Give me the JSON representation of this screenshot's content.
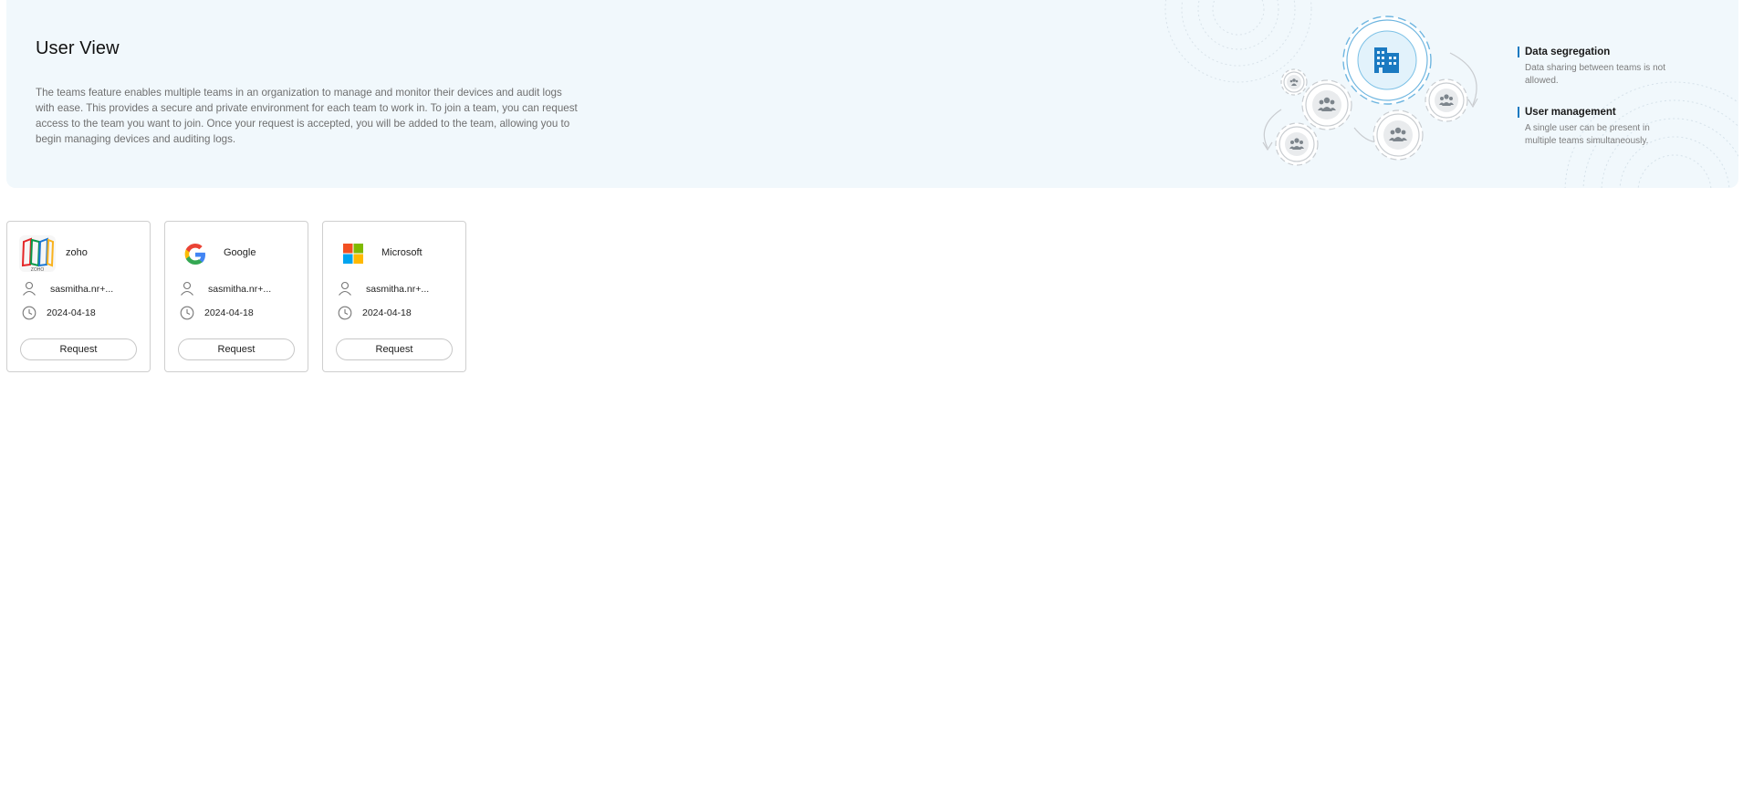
{
  "header": {
    "title": "User View",
    "description": "The teams feature enables multiple teams in an organization to manage and monitor their devices and audit logs with ease. This provides a secure and private environment for each team to work in. To join a team, you can request access to the team you want to join. Once your request is accepted, you will be added to the team, allowing you to begin managing devices and auditing logs."
  },
  "features": [
    {
      "title": "Data segregation",
      "description": "Data sharing between teams is not allowed."
    },
    {
      "title": "User management",
      "description": "A single user can be present in multiple teams simultaneously."
    }
  ],
  "teams": [
    {
      "name": "zoho",
      "logo": "zoho-logo",
      "owner": "sasmitha.nr+...",
      "date": "2024-04-18",
      "action": "Request"
    },
    {
      "name": "Google",
      "logo": "google-logo",
      "owner": "sasmitha.nr+...",
      "date": "2024-04-18",
      "action": "Request"
    },
    {
      "name": "Microsoft",
      "logo": "microsoft-logo",
      "owner": "sasmitha.nr+...",
      "date": "2024-04-18",
      "action": "Request"
    }
  ],
  "icons": {
    "building": "building-icon",
    "team": "team-icon",
    "user": "user-icon",
    "clock": "clock-icon"
  },
  "colors": {
    "accent": "#1b7ac1",
    "banner_bg": "#f1f8fc",
    "zoho_red": "#e42527",
    "zoho_green": "#089949",
    "zoho_blue": "#1976d2",
    "zoho_yellow": "#f9b21d",
    "ms_red": "#f25022",
    "ms_green": "#7fba00",
    "ms_blue": "#00a4ef",
    "ms_yellow": "#ffb900"
  }
}
